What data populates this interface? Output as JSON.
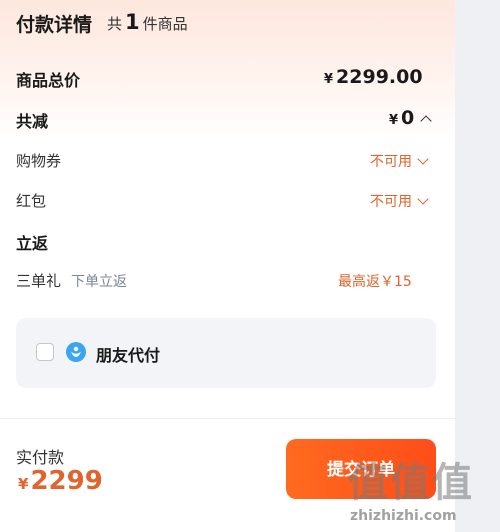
{
  "header": {
    "title": "付款详情",
    "count_prefix": "共",
    "count": "1",
    "count_suffix": "件商品"
  },
  "summary": {
    "total_label": "商品总价",
    "total_currency": "¥",
    "total_value": "2299.00",
    "discount_label": "共减",
    "discount_currency": "¥",
    "discount_value": "0"
  },
  "coupons": {
    "shopping_label": "购物券",
    "shopping_status": "不可用",
    "redpacket_label": "红包",
    "redpacket_status": "不可用"
  },
  "rebate": {
    "section_label": "立返",
    "item_label": "三单礼",
    "item_sub": "下单立返",
    "item_value": "最高返￥15"
  },
  "friend_pay": {
    "label": "朋友代付",
    "checked": false
  },
  "footer": {
    "actual_label": "实付款",
    "actual_currency": "¥",
    "actual_value": "2299",
    "submit_label": "提交订单"
  },
  "watermark": {
    "glyphs": "值值值",
    "url": "zhizhizhi.com"
  },
  "colors": {
    "accent": "#e2632b",
    "button": "#ff5a1f",
    "friend_icon": "#3aa6f0"
  }
}
